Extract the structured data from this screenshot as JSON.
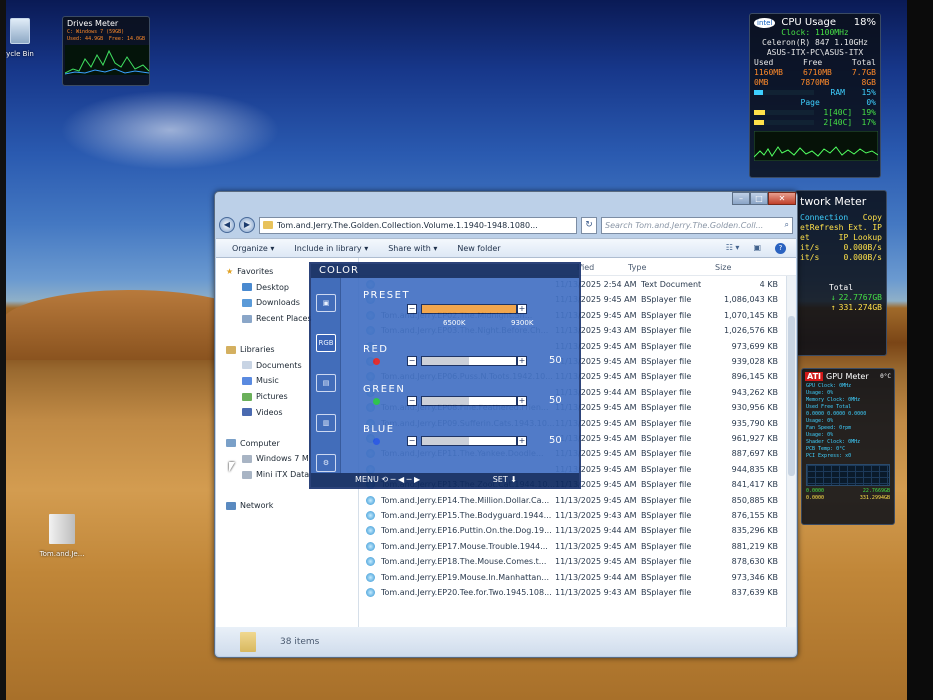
{
  "desktop": {
    "recycle_label": "ycle Bin",
    "folder_label": "Tom.and.Je..."
  },
  "drives_gadget": {
    "title": "Drives Meter",
    "line1": "C: Windows 7 (59GB)",
    "line2": "Used: 44.9GB",
    "line3": "Free: 14.0GB"
  },
  "cpu_gadget": {
    "logo": "intel",
    "title": "CPU Usage",
    "percent": "18%",
    "clock": "Clock: 1100MHz",
    "cpu_name": "Celeron(R) 847 1.10GHz",
    "host": "ASUS-ITX-PC\\ASUS-ITX",
    "head_used": "Used",
    "head_free": "Free",
    "head_total": "Total",
    "ram_used": "1160MB",
    "ram_free": "6710MB",
    "ram_total": "7.7GB",
    "page_used": "0MB",
    "page_free": "7870MB",
    "page_total": "8GB",
    "ram_label": "RAM",
    "ram_pct": "15%",
    "page_label": "Page",
    "page_pct": "0%",
    "core1_label": "1[40C]",
    "core1_pct": "19%",
    "core2_label": "2[40C]",
    "core2_pct": "17%",
    "ram_fraction": 0.15,
    "core1_fraction": 0.19,
    "core2_fraction": 0.17
  },
  "network_gadget": {
    "title": "twork Meter",
    "r1a": "Connection",
    "r1b": "Copy",
    "r2a": "et",
    "r2b": "Refresh Ext. IP",
    "r3a": "et",
    "r3b": "IP Lookup",
    "r4a": "it/s",
    "r4b": "0.000B/s",
    "r5a": "it/s",
    "r5b": "0.000B/s",
    "total_label": "Total",
    "total_down": "22.7767GB",
    "total_up": "331.274GB"
  },
  "gpu_gadget": {
    "logo": "ATI",
    "title": "GPU Meter",
    "temp": "0°C",
    "line1": "GPU Clock: 0MHz",
    "line2": "Usage: 0%",
    "line3": "Memory Clock: 0MHz",
    "line4": "Used   Free   Total",
    "line5": "0.0000 0.0000 0.0000",
    "line6": "Usage: 0%",
    "line7": "Fan Speed: 0rpm",
    "line8": "Usage: 0%",
    "line9": "Shader Clock: 0MHz",
    "line10": "PCB Temp: 0°C",
    "line11": "PCI Express: x0",
    "f1": "0.0000",
    "f2": "22.7669GB",
    "f3": "0.0000",
    "f4": "331.2994GB"
  },
  "explorer": {
    "address": "Tom.and.Jerry.The.Golden.Collection.Volume.1.1940-1948.1080...",
    "search_placeholder": "Search Tom.and.Jerry.The.Golden.Coll...",
    "cmd_organize": "Organize ▾",
    "cmd_library": "Include in library ▾",
    "cmd_share": "Share with ▾",
    "cmd_newfolder": "New folder",
    "col_modified": "ified",
    "col_type": "Type",
    "col_size": "Size",
    "nav": {
      "favorites": "Favorites",
      "desktop": "Desktop",
      "downloads": "Downloads",
      "recent": "Recent Places",
      "libraries": "Libraries",
      "documents": "Documents",
      "music": "Music",
      "pictures": "Pictures",
      "videos": "Videos",
      "computer": "Computer",
      "win7": "Windows 7 M",
      "miniitx": "Mini iTX Data",
      "network": "Network"
    },
    "rows": [
      {
        "name": "",
        "date": "11/13/2025 2:54 AM",
        "type": "Text Document",
        "size": "4 KB"
      },
      {
        "name": "",
        "date": "11/13/2025 9:45 AM",
        "type": "BSplayer file",
        "size": "1,086,043 KB"
      },
      {
        "name": "Tom.and.Jerry.EP02.The.Midnight.Sn...",
        "date": "11/13/2025 9:45 AM",
        "type": "BSplayer file",
        "size": "1,070,145 KB"
      },
      {
        "name": "Tom.and.Jerry.EP03.The.Night.Before.Ch...",
        "date": "11/13/2025 9:43 AM",
        "type": "BSplayer file",
        "size": "1,026,576 KB"
      },
      {
        "name": "",
        "date": "11/13/2025 9:45 AM",
        "type": "BSplayer file",
        "size": "973,699 KB"
      },
      {
        "name": "",
        "date": "11/13/2025 9:45 AM",
        "type": "BSplayer file",
        "size": "939,028 KB"
      },
      {
        "name": "Tom.and.Jerry.EP06.Puss.N.Toots.1942.10...",
        "date": "11/13/2025 9:45 AM",
        "type": "BSplayer file",
        "size": "896,145 KB"
      },
      {
        "name": "",
        "date": "11/13/2025 9:44 AM",
        "type": "BSplayer file",
        "size": "943,262 KB"
      },
      {
        "name": "Tom.and.Jerry.EP08.Fine.Feathered.Frien...",
        "date": "11/13/2025 9:45 AM",
        "type": "BSplayer file",
        "size": "930,956 KB"
      },
      {
        "name": "Tom.and.Jerry.EP09.Sufferin.Cats.1943.10...",
        "date": "11/13/2025 9:45 AM",
        "type": "BSplayer file",
        "size": "935,790 KB"
      },
      {
        "name": "",
        "date": "11/13/2025 9:45 AM",
        "type": "BSplayer file",
        "size": "961,927 KB"
      },
      {
        "name": "Tom.and.Jerry.EP11.The.Yankee.Doodle...",
        "date": "11/13/2025 9:45 AM",
        "type": "BSplayer file",
        "size": "887,697 KB"
      },
      {
        "name": "",
        "date": "11/13/2025 9:45 AM",
        "type": "BSplayer file",
        "size": "944,835 KB"
      },
      {
        "name": "Tom.and.Jerry.EP13.The.Zoot.Cat.1944.10...",
        "date": "11/13/2025 9:45 AM",
        "type": "BSplayer file",
        "size": "841,417 KB"
      },
      {
        "name": "Tom.and.Jerry.EP14.The.Million.Dollar.Ca...",
        "date": "11/13/2025 9:45 AM",
        "type": "BSplayer file",
        "size": "850,885 KB"
      },
      {
        "name": "Tom.and.Jerry.EP15.The.Bodyguard.1944...",
        "date": "11/13/2025 9:43 AM",
        "type": "BSplayer file",
        "size": "876,155 KB"
      },
      {
        "name": "Tom.and.Jerry.EP16.Puttin.On.the.Dog.19...",
        "date": "11/13/2025 9:44 AM",
        "type": "BSplayer file",
        "size": "835,296 KB"
      },
      {
        "name": "Tom.and.Jerry.EP17.Mouse.Trouble.1944...",
        "date": "11/13/2025 9:45 AM",
        "type": "BSplayer file",
        "size": "881,219 KB"
      },
      {
        "name": "Tom.and.Jerry.EP18.The.Mouse.Comes.t...",
        "date": "11/13/2025 9:45 AM",
        "type": "BSplayer file",
        "size": "878,630 KB"
      },
      {
        "name": "Tom.and.Jerry.EP19.Mouse.In.Manhattan...",
        "date": "11/13/2025 9:44 AM",
        "type": "BSplayer file",
        "size": "973,346 KB"
      },
      {
        "name": "Tom.and.Jerry.EP20.Tee.for.Two.1945.108...",
        "date": "11/13/2025 9:43 AM",
        "type": "BSplayer file",
        "size": "837,639 KB"
      }
    ],
    "status_count": "38 items"
  },
  "osd": {
    "title": "COLOR",
    "preset_label": "PRESET",
    "preset_low": "6500K",
    "preset_high": "9300K",
    "red_label": "RED",
    "red_value": "50",
    "green_label": "GREEN",
    "green_value": "50",
    "blue_label": "BLUE",
    "blue_value": "50",
    "footer_menu": "MENU",
    "footer_set": "SET",
    "level_fraction": 0.5,
    "tab_rgb": "RGB",
    "red_color": "#e02020",
    "green_color": "#20c040",
    "blue_color": "#2050e0"
  }
}
